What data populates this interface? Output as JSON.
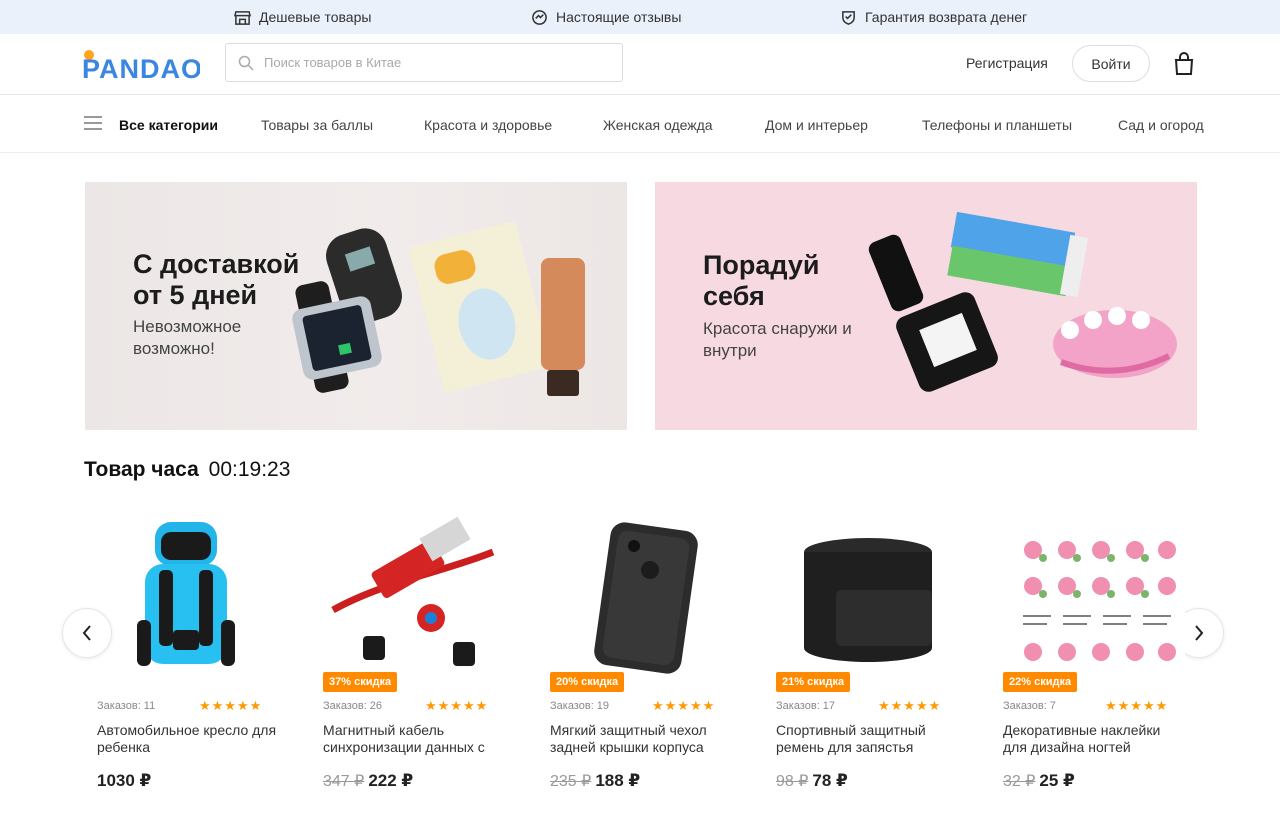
{
  "promo": {
    "items": [
      {
        "label": "Дешевые товары",
        "icon": "store-icon"
      },
      {
        "label": "Настоящие отзывы",
        "icon": "review-icon"
      },
      {
        "label": "Гарантия возврата денег",
        "icon": "shield-icon"
      }
    ]
  },
  "header": {
    "logo_text": "PANDAO",
    "search_placeholder": "Поиск товаров в Китае",
    "register_label": "Регистрация",
    "login_label": "Войти"
  },
  "nav": {
    "all_label": "Все категории",
    "categories": [
      "Товары за баллы",
      "Красота и здоровье",
      "Женская одежда",
      "Дом и интерьер",
      "Телефоны и планшеты",
      "Сад и огород"
    ]
  },
  "banners": [
    {
      "title": "С доставкой от 5 дней",
      "subtitle": "Невозможное возможно!"
    },
    {
      "title": "Порадуй себя",
      "subtitle": "Красота снаружи и внутри"
    }
  ],
  "deal": {
    "label": "Товар часа",
    "timer": "00:19:23"
  },
  "products": [
    {
      "name": "Автомобильное кресло для ребенка",
      "orders": "Заказов: 11",
      "rating": 5,
      "stars": "★★★★★",
      "price": "1030 ₽",
      "old_price": "",
      "discount": ""
    },
    {
      "name": "Магнитный кабель синхронизации данных с",
      "orders": "Заказов: 26",
      "rating": 5,
      "stars": "★★★★★",
      "price": "222 ₽",
      "old_price": "347 ₽",
      "discount": "37% скидка"
    },
    {
      "name": "Мягкий защитный чехол задней крышки корпуса для",
      "orders": "Заказов: 19",
      "rating": 5,
      "stars": "★★★★★",
      "price": "188 ₽",
      "old_price": "235 ₽",
      "discount": "20% скидка"
    },
    {
      "name": "Спортивный защитный ремень для запястья",
      "orders": "Заказов: 17",
      "rating": 5,
      "stars": "★★★★★",
      "price": "78 ₽",
      "old_price": "98 ₽",
      "discount": "21% скидка"
    },
    {
      "name": "Декоративные наклейки для дизайна ногтей",
      "orders": "Заказов: 7",
      "rating": 5,
      "stars": "★★★★★",
      "price": "25 ₽",
      "old_price": "32 ₽",
      "discount": "22% скидка"
    }
  ],
  "colors": {
    "promo_bg": "#eaf1fb",
    "badge": "#ff8a00",
    "star": "#ff9900",
    "logo_blue": "#3a86e0",
    "logo_orange": "#ffa41b"
  }
}
